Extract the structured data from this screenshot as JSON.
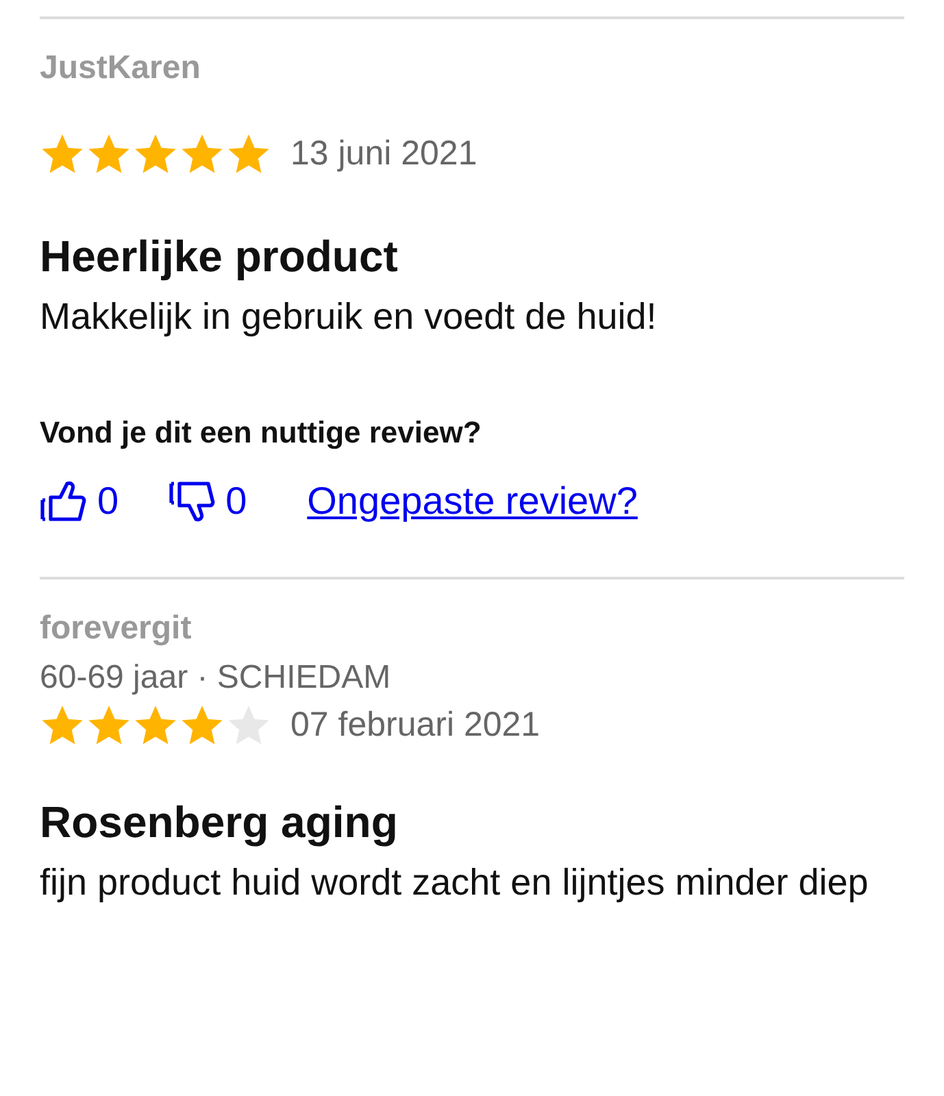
{
  "reviews": [
    {
      "author": "JustKaren",
      "stars": 5,
      "date": "13 juni 2021",
      "title": "Heerlijke product",
      "body": "Makkelijk in gebruik en voedt de huid!",
      "feedback": {
        "question": "Vond je dit een nuttige review?",
        "likes": "0",
        "dislikes": "0",
        "report": "Ongepaste review?"
      }
    },
    {
      "author": "forevergit",
      "meta": "60-69 jaar · SCHIEDAM",
      "stars": 4,
      "date": "07 februari 2021",
      "title": "Rosenberg aging",
      "body": "fijn product huid wordt zacht en lijntjes minder diep"
    }
  ]
}
